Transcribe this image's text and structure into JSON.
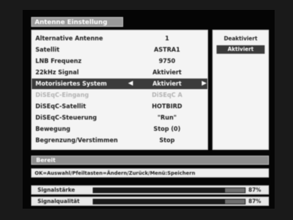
{
  "menu": {
    "title": "Antenne Einstellung",
    "items": [
      {
        "label": "Alternative Antenne",
        "value": "1",
        "state": "normal"
      },
      {
        "label": "Satellit",
        "value": "ASTRA1",
        "state": "normal"
      },
      {
        "label": "LNB Frequenz",
        "value": "9750",
        "state": "normal"
      },
      {
        "label": "22kHz Signal",
        "value": "Aktiviert",
        "state": "normal"
      },
      {
        "label": "Motorisiertes System",
        "value": "Aktiviert",
        "state": "selected"
      },
      {
        "label": "DiSEqC-Eingang",
        "value": "DiSEqC A",
        "state": "disabled"
      },
      {
        "label": "DiSEqC-Satellit",
        "value": "HOTBIRD",
        "state": "normal"
      },
      {
        "label": "DiSEqC-Steuerung",
        "value": "\"Run\"",
        "state": "normal"
      },
      {
        "label": "Bewegung",
        "value": "Stop (0)",
        "state": "normal"
      },
      {
        "label": "Begrenzung/Verstimmen",
        "value": "Stop",
        "state": "normal"
      }
    ]
  },
  "options": [
    {
      "label": "Deaktiviert",
      "active": false
    },
    {
      "label": "Aktiviert",
      "active": true
    }
  ],
  "status": {
    "text": "Bereit"
  },
  "help": {
    "text": "OK=Auswahl/Pfeiltasten=Ändern/Zurück/Menü:Speichern"
  },
  "meters": [
    {
      "label": "Signalstärke",
      "value_text": "87%",
      "level": 0.87
    },
    {
      "label": "Signalqualität",
      "value_text": "87%",
      "level": 0.87
    }
  ]
}
